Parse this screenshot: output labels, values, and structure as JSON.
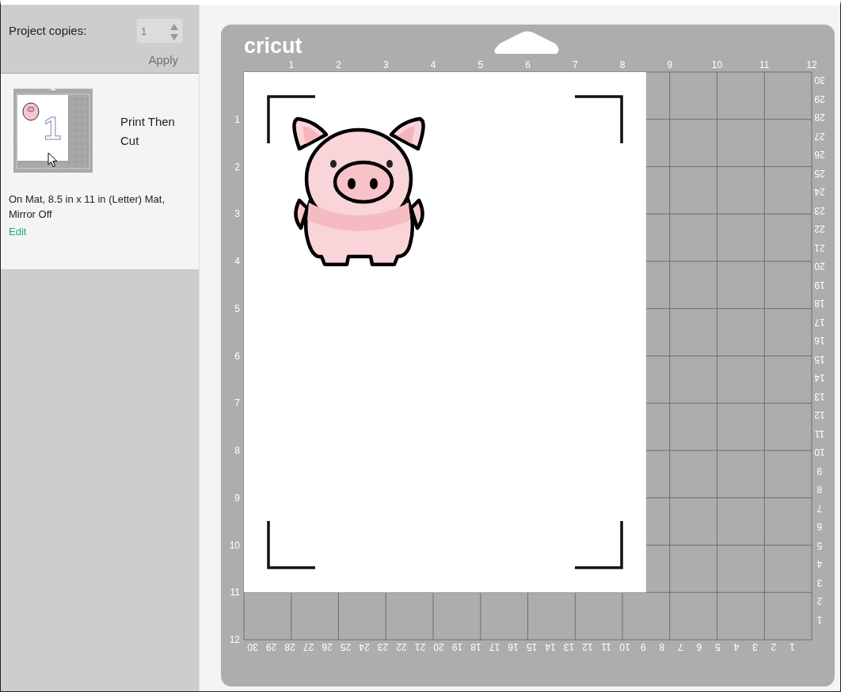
{
  "copies": {
    "label": "Project copies:",
    "value": "1",
    "disabled": true
  },
  "apply_button": {
    "label": "Apply",
    "disabled": true
  },
  "mat_card": {
    "thumbnail_number": "1",
    "title": "Print Then Cut",
    "details": "On Mat, 8.5 in x 11 in (Letter) Mat, Mirror Off",
    "edit_link": "Edit"
  },
  "mat": {
    "logo": "cricut",
    "top_ruler": [
      "1",
      "2",
      "3",
      "4",
      "5",
      "6",
      "7",
      "8",
      "9",
      "10",
      "11",
      "12"
    ],
    "left_ruler": [
      "1",
      "2",
      "3",
      "4",
      "5",
      "6",
      "7",
      "8",
      "9",
      "10",
      "11",
      "12"
    ],
    "right_ruler": [
      "30",
      "29",
      "28",
      "27",
      "26",
      "25",
      "24",
      "23",
      "22",
      "21",
      "20",
      "19",
      "18",
      "17",
      "16",
      "15",
      "14",
      "13",
      "12",
      "11",
      "10",
      "9",
      "8",
      "7",
      "6",
      "5",
      "4",
      "3",
      "2",
      "1"
    ],
    "bottom_ruler": [
      "30",
      "29",
      "28",
      "27",
      "26",
      "25",
      "24",
      "23",
      "22",
      "21",
      "20",
      "19",
      "18",
      "17",
      "16",
      "15",
      "14",
      "13",
      "12",
      "11",
      "10",
      "9",
      "8",
      "7",
      "6",
      "5",
      "4",
      "3",
      "2",
      "1"
    ]
  }
}
